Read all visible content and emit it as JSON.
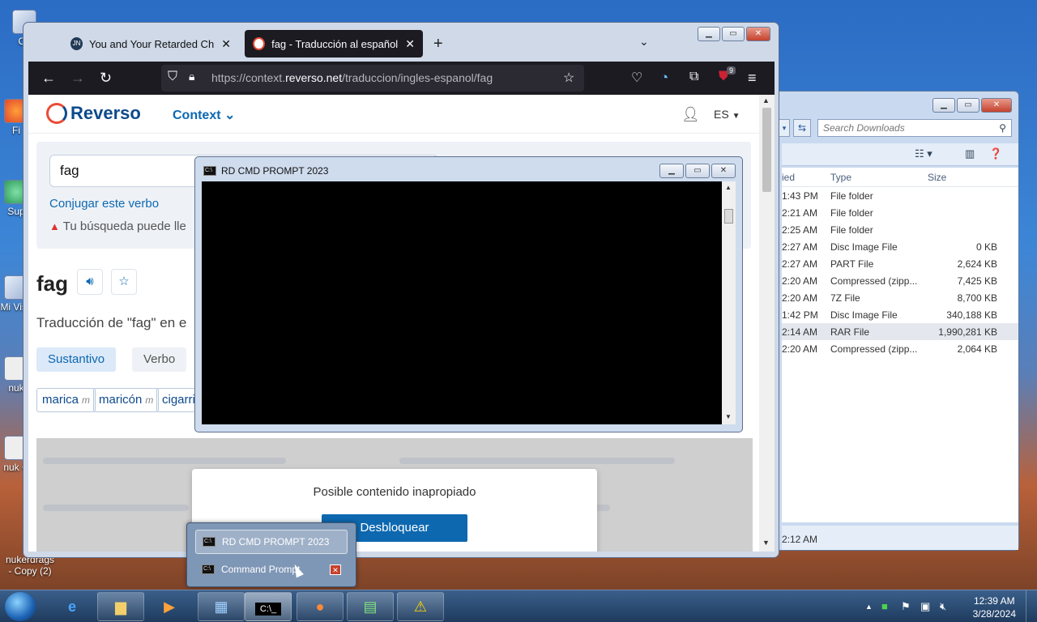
{
  "desktop": {
    "icons": [
      {
        "label": "Co",
        "x_note": ""
      },
      {
        "label": "Fi"
      },
      {
        "label": "Sup"
      },
      {
        "label": "Mi Visu"
      },
      {
        "label": "nuk"
      },
      {
        "label": "nuk C"
      },
      {
        "label": "nukerdrags - Copy (2)"
      }
    ]
  },
  "explorer": {
    "search_placeholder": "Search Downloads",
    "columns": {
      "modified": "ied",
      "type": "Type",
      "size": "Size"
    },
    "rows": [
      {
        "time": "1:43 PM",
        "type": "File folder",
        "size": ""
      },
      {
        "time": "2:21 AM",
        "type": "File folder",
        "size": ""
      },
      {
        "time": "2:25 AM",
        "type": "File folder",
        "size": ""
      },
      {
        "time": "2:27 AM",
        "type": "Disc Image File",
        "size": "0 KB"
      },
      {
        "time": "2:27 AM",
        "type": "PART File",
        "size": "2,624 KB"
      },
      {
        "time": "2:20 AM",
        "type": "Compressed (zipp...",
        "size": "7,425 KB"
      },
      {
        "time": "2:20 AM",
        "type": "7Z File",
        "size": "8,700 KB"
      },
      {
        "time": "1:42 PM",
        "type": "Disc Image File",
        "size": "340,188 KB"
      },
      {
        "time": "2:14 AM",
        "type": "RAR File",
        "size": "1,990,281 KB"
      },
      {
        "time": "2:20 AM",
        "type": "Compressed (zipp...",
        "size": "2,064 KB"
      }
    ],
    "status_time": "2:12 AM"
  },
  "firefox": {
    "tabs": [
      {
        "favicon": "JN",
        "title": "You and Your Retarded Child: A"
      },
      {
        "favicon": "",
        "title": "fag - Traducción al español - ej"
      }
    ],
    "url_prefix": "https://context.",
    "url_host": "reverso.net",
    "url_path": "/traduccion/ingles-espanol/fag",
    "ublock_count": "9"
  },
  "reverso": {
    "logo": "Reverso",
    "context_label": "Context",
    "lang": "ES",
    "search_value": "fag",
    "conjugate_link": "Conjugar este verbo",
    "warning_text": "Tu búsqueda puede lle",
    "word": "fag",
    "translation_heading": "Traducción de \"fag\" en e",
    "pos_tabs": [
      "Sustantivo",
      "Verbo"
    ],
    "chips": [
      {
        "word": "marica",
        "gender": "m"
      },
      {
        "word": "maricón",
        "gender": "m"
      },
      {
        "word": "cigarril",
        "gender": ""
      }
    ],
    "modal_message": "Posible contenido inapropiado",
    "unlock_button": "Desbloquear"
  },
  "cmd": {
    "title": "RD CMD PROMPT 2023"
  },
  "jumplist": {
    "items": [
      "RD CMD PROMPT 2023",
      "Command Prompt"
    ]
  },
  "taskbar": {
    "time": "12:39 AM",
    "date": "3/28/2024"
  }
}
